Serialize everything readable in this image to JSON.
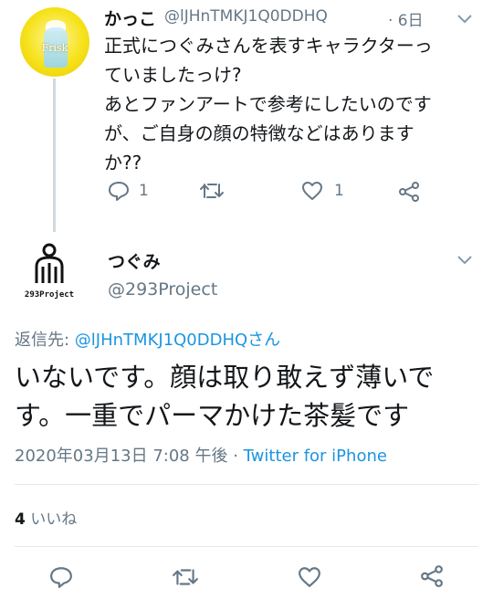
{
  "reply_tweet": {
    "display_name": "かっこ",
    "handle": "@lJHnTMKJ1Q0DDHQ",
    "time": "· 6日",
    "avatar_text": "Frisk",
    "body": "正式につぐみさんを表すキャラクターっ\nていましたっけ?\nあとファンアートで参考にしたいのです\nが、ご自身の顔の特徴などはあります\nか??",
    "reply_count": "1",
    "retweet_count": "",
    "like_count": "1"
  },
  "main_tweet": {
    "display_name": "つぐみ",
    "handle": "@293Project",
    "avatar_text": "293Project",
    "reply_to_label": "返信先: ",
    "reply_to_mention": "@lJHnTMKJ1Q0DDHQさん",
    "body": "いないです。顔は取り敢えず薄いで\nす。一重でパーマかけた茶髪です",
    "timestamp": "2020年03月13日 7:08 午後 · ",
    "source": "Twitter for iPhone",
    "like_count": "4",
    "like_label": " いいね"
  },
  "icons": {
    "reply": "reply-icon",
    "retweet": "retweet-icon",
    "like": "heart-icon",
    "share": "share-icon",
    "more": "chevron-down-icon"
  },
  "colors": {
    "link": "#1b95e0",
    "muted": "#657786",
    "text": "#14171a",
    "avatar_bg": "#f6e21b"
  }
}
